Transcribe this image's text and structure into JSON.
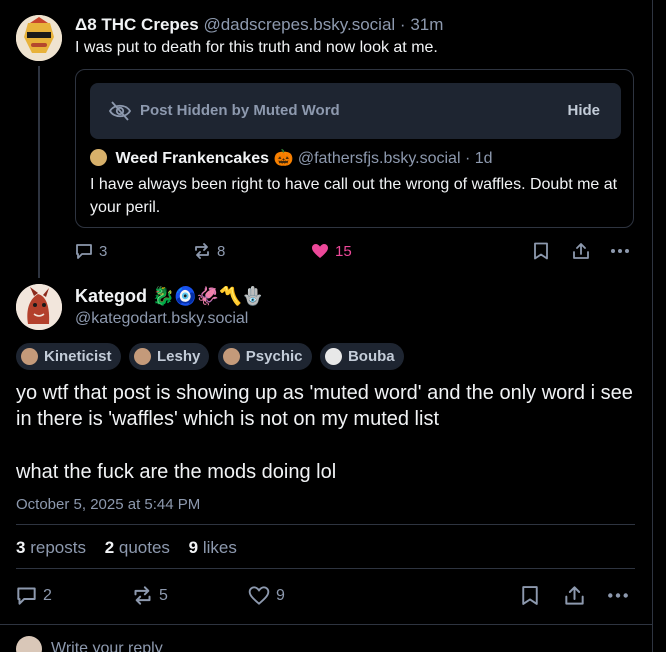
{
  "parent_post": {
    "display_name": "Δ8 THC Crepes",
    "handle": "@dadscrepes.bsky.social",
    "separator": "·",
    "time": "31m",
    "text": "I was put to death for this truth and now look at me.",
    "muted_notice": "Post Hidden by Muted Word",
    "hide_label": "Hide",
    "quoted": {
      "display_name": "Weed Frankencakes 🎃",
      "handle": "@fathersfjs.bsky.social",
      "separator": "·",
      "time": "1d",
      "text": "I have always been right to have call out the wrong of waffles. Doubt me at your peril."
    },
    "actions": {
      "replies": "3",
      "reposts": "8",
      "likes": "15"
    }
  },
  "main_post": {
    "display_name": "Kategod 🐉🧿🦑〽️🪬",
    "handle": "@kategodart.bsky.social",
    "tags": [
      "Kineticist",
      "Leshy",
      "Psychic",
      "Bouba"
    ],
    "text_line1": "yo wtf that post is showing up as 'muted word' and the only word i see in there is 'waffles' which is not on my muted list",
    "text_line2": "what the fuck are the mods doing lol",
    "timestamp": "October 5, 2025 at 5:44 PM",
    "stats": {
      "reposts_count": "3",
      "reposts_label": "reposts",
      "quotes_count": "2",
      "quotes_label": "quotes",
      "likes_count": "9",
      "likes_label": "likes"
    },
    "actions": {
      "replies": "2",
      "reposts": "5",
      "likes": "9"
    }
  },
  "reply_box": {
    "placeholder": "Write your reply"
  },
  "colors": {
    "background": "#000000",
    "text": "#f1f3f5",
    "muted_text": "#8d99ae",
    "like_active": "#ec4899",
    "card_border": "#2e3440",
    "muted_notice_bg": "#1e2531"
  }
}
